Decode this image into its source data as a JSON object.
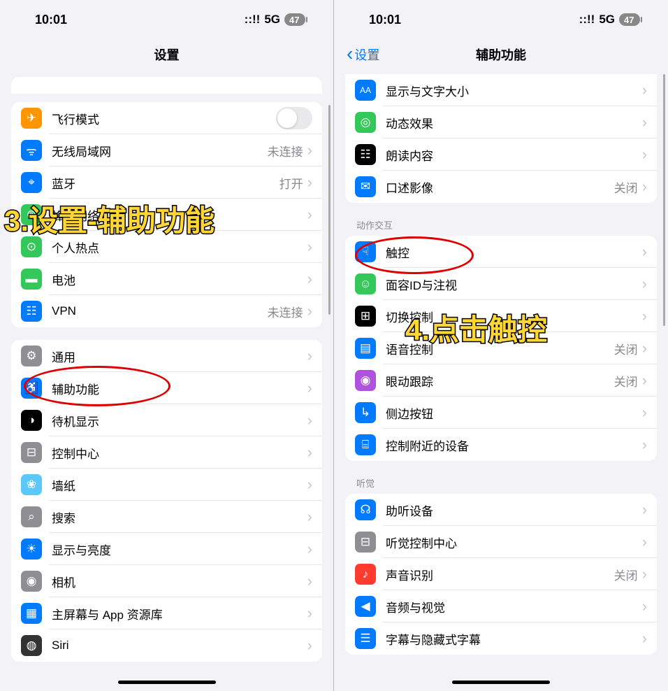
{
  "left": {
    "status": {
      "time": "10:01",
      "signal": "::!!",
      "net": "5G",
      "battery": "47"
    },
    "title": "设置",
    "annotation": "3.设置-辅助功能",
    "group1": [
      {
        "key": "airplane",
        "label": "飞行模式",
        "value": "",
        "icon_bg": "ic-orange",
        "glyph": "✈",
        "toggle": true
      },
      {
        "key": "wifi",
        "label": "无线局域网",
        "value": "未连接",
        "icon_bg": "ic-blue",
        "glyph": "ᯤ"
      },
      {
        "key": "bluetooth",
        "label": "蓝牙",
        "value": "打开",
        "icon_bg": "ic-blue",
        "glyph": "⌖"
      },
      {
        "key": "cellular",
        "label": "蜂窝网络",
        "value": "",
        "icon_bg": "ic-green",
        "glyph": "⊚"
      },
      {
        "key": "hotspot",
        "label": "个人热点",
        "value": "",
        "icon_bg": "ic-green",
        "glyph": "⊙"
      },
      {
        "key": "battery",
        "label": "电池",
        "value": "",
        "icon_bg": "ic-green",
        "glyph": "▬"
      },
      {
        "key": "vpn",
        "label": "VPN",
        "value": "未连接",
        "icon_bg": "ic-blue",
        "glyph": "☷"
      }
    ],
    "group2": [
      {
        "key": "general",
        "label": "通用",
        "icon_bg": "ic-gray",
        "glyph": "⚙"
      },
      {
        "key": "accessibility",
        "label": "辅助功能",
        "icon_bg": "ic-blue",
        "glyph": "♿"
      },
      {
        "key": "standby",
        "label": "待机显示",
        "icon_bg": "ic-black",
        "glyph": "◑"
      },
      {
        "key": "control",
        "label": "控制中心",
        "icon_bg": "ic-gray",
        "glyph": "⊟"
      },
      {
        "key": "wallpaper",
        "label": "墙纸",
        "icon_bg": "ic-cyan",
        "glyph": "❀"
      },
      {
        "key": "search",
        "label": "搜索",
        "icon_bg": "ic-gray",
        "glyph": "⌕"
      },
      {
        "key": "display",
        "label": "显示与亮度",
        "icon_bg": "ic-blue",
        "glyph": "☀"
      },
      {
        "key": "camera",
        "label": "相机",
        "icon_bg": "ic-gray",
        "glyph": "◉"
      },
      {
        "key": "home",
        "label": "主屏幕与 App 资源库",
        "icon_bg": "ic-blue",
        "glyph": "▦"
      },
      {
        "key": "siri",
        "label": "Siri",
        "icon_bg": "ic-darkgray",
        "glyph": "◍"
      }
    ]
  },
  "right": {
    "status": {
      "time": "10:01",
      "signal": "::!!",
      "net": "5G",
      "battery": "47"
    },
    "back": "设置",
    "title": "辅助功能",
    "annotation": "4.点击触控",
    "group0": [
      {
        "key": "textsize",
        "label": "显示与文字大小",
        "value": "",
        "icon_bg": "ic-blue",
        "glyph": "AA"
      },
      {
        "key": "motion",
        "label": "动态效果",
        "value": "",
        "icon_bg": "ic-green",
        "glyph": "◎"
      },
      {
        "key": "spoken",
        "label": "朗读内容",
        "value": "",
        "icon_bg": "ic-black",
        "glyph": "☷"
      },
      {
        "key": "audiodesc",
        "label": "口述影像",
        "value": "关闭",
        "icon_bg": "ic-blue",
        "glyph": "✉"
      }
    ],
    "header1": "动作交互",
    "group1": [
      {
        "key": "touch",
        "label": "触控",
        "value": "",
        "icon_bg": "ic-blue",
        "glyph": "☟"
      },
      {
        "key": "faceid",
        "label": "面容ID与注视",
        "value": "",
        "icon_bg": "ic-green",
        "glyph": "☺"
      },
      {
        "key": "switch",
        "label": "切换控制",
        "value": "",
        "icon_bg": "ic-black",
        "glyph": "⊞"
      },
      {
        "key": "voice",
        "label": "语音控制",
        "value": "关闭",
        "icon_bg": "ic-blue",
        "glyph": "▤"
      },
      {
        "key": "eyetrack",
        "label": "眼动跟踪",
        "value": "关闭",
        "icon_bg": "ic-purple",
        "glyph": "◉"
      },
      {
        "key": "sidebtn",
        "label": "侧边按钮",
        "value": "",
        "icon_bg": "ic-blue",
        "glyph": "↳"
      },
      {
        "key": "nearby",
        "label": "控制附近的设备",
        "value": "",
        "icon_bg": "ic-blue",
        "glyph": "⌸"
      }
    ],
    "header2": "听觉",
    "group2": [
      {
        "key": "hearing",
        "label": "助听设备",
        "value": "",
        "icon_bg": "ic-blue",
        "glyph": "☊"
      },
      {
        "key": "hearingctrl",
        "label": "听觉控制中心",
        "value": "",
        "icon_bg": "ic-gray",
        "glyph": "⊟"
      },
      {
        "key": "soundrec",
        "label": "声音识别",
        "value": "关闭",
        "icon_bg": "ic-red",
        "glyph": "♪"
      },
      {
        "key": "audiovisual",
        "label": "音频与视觉",
        "value": "",
        "icon_bg": "ic-blue",
        "glyph": "◀"
      },
      {
        "key": "subtitles",
        "label": "字幕与隐藏式字幕",
        "value": "",
        "icon_bg": "ic-blue",
        "glyph": "☰"
      }
    ]
  }
}
